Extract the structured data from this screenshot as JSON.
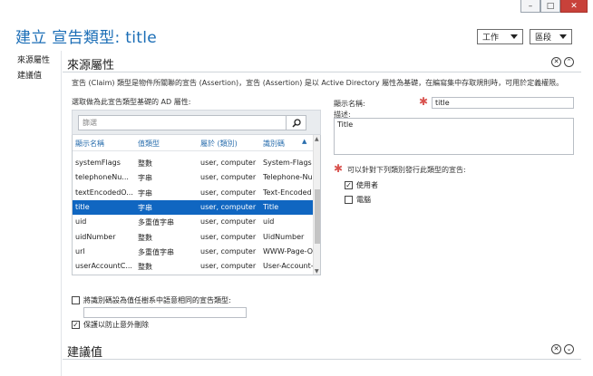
{
  "window": {
    "minimize_glyph": "–",
    "maximize_glyph": "□",
    "close_glyph": "✕"
  },
  "header": {
    "title": "建立 宣告類型: title",
    "tasks_label": "工作",
    "sections_label": "區段"
  },
  "nav": {
    "items": [
      {
        "label": "來源屬性"
      },
      {
        "label": "建議值"
      }
    ]
  },
  "source_section": {
    "title": "來源屬性",
    "description": "宣告 (Claim) 類型是物件所關聯的宣告 (Assertion)，宣告 (Assertion) 是以 Active Directory 屬性為基礎，在編寫集中存取規則時，可用於定義權限。",
    "select_label": "選取做為此宣告類型基礎的 AD 屬性:",
    "search_placeholder": "篩選",
    "columns": [
      "顯示名稱",
      "值類型",
      "屬於 (類別)",
      "識別碼"
    ],
    "rows": [
      {
        "name": "systemFlags",
        "type": "整數",
        "class": "user, computer",
        "id": "System-Flags",
        "selected": false
      },
      {
        "name": "telephoneNu...",
        "type": "字串",
        "class": "user, computer",
        "id": "Telephone-Nu",
        "selected": false
      },
      {
        "name": "textEncodedO...",
        "type": "字串",
        "class": "user, computer",
        "id": "Text-Encoded",
        "selected": false
      },
      {
        "name": "title",
        "type": "字串",
        "class": "user, computer",
        "id": "Title",
        "selected": true
      },
      {
        "name": "uid",
        "type": "多重值字串",
        "class": "user, computer",
        "id": "uid",
        "selected": false
      },
      {
        "name": "uidNumber",
        "type": "整數",
        "class": "user, computer",
        "id": "UidNumber",
        "selected": false
      },
      {
        "name": "url",
        "type": "多重值字串",
        "class": "user, computer",
        "id": "WWW-Page-O",
        "selected": false
      },
      {
        "name": "userAccountC...",
        "type": "整數",
        "class": "user, computer",
        "id": "User-Account-",
        "selected": false
      }
    ],
    "set_id_label": "將識別碼設為值任樹系中語意相同的宣告類型:",
    "set_id_checked": false,
    "protect_label": "保護以防止意外刪除",
    "protect_checked": true,
    "display_name_label": "顯示名稱:",
    "display_name_value": "title",
    "description_label": "描述:",
    "description_value": "Title",
    "issue_for_label": "可以針對下列類別發行此類型的宣告:",
    "classes": [
      {
        "label": "使用者",
        "checked": true
      },
      {
        "label": "電腦",
        "checked": false
      }
    ]
  },
  "suggested_section": {
    "title": "建議值"
  },
  "icons": {
    "close": "✕",
    "collapse": "⌃",
    "expand": "⌄"
  }
}
